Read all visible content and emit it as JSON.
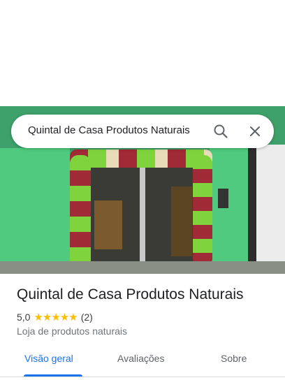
{
  "search": {
    "query": "Quintal de Casa Produtos Naturais",
    "search_icon": "search-icon",
    "close_icon": "close-icon"
  },
  "place": {
    "name": "Quintal de Casa Produtos Naturais",
    "rating": "5,0",
    "stars": "★★★★★",
    "review_count": "(2)",
    "category": "Loja de produtos naturais"
  },
  "tabs": [
    {
      "label": "Visão geral",
      "active": true
    },
    {
      "label": "Avaliações",
      "active": false
    },
    {
      "label": "Sobre",
      "active": false
    }
  ],
  "colors": {
    "accent": "#1a73e8",
    "star": "#fbbc04"
  }
}
